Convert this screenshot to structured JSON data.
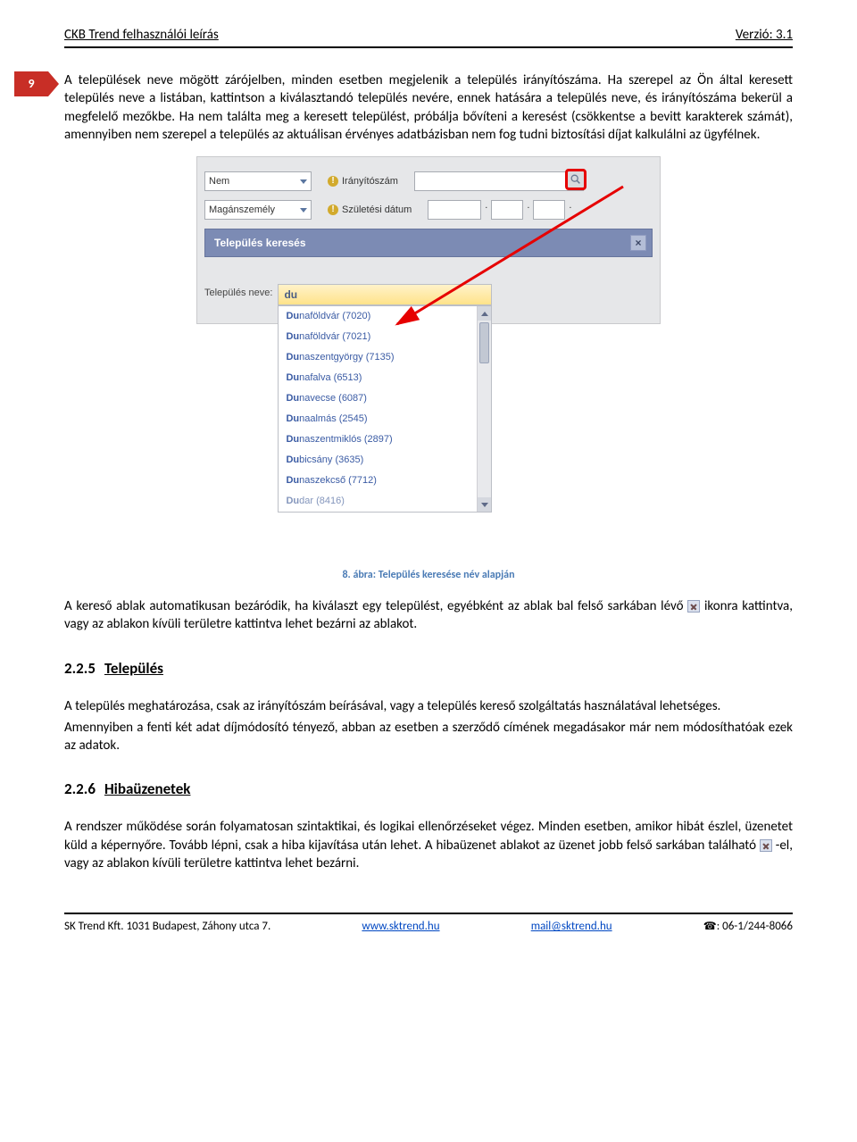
{
  "header": {
    "doc_title": "CKB Trend felhasználói leírás",
    "version": "Verzió: 3.1"
  },
  "page_marker": "9",
  "para1": "A települések neve mögött zárójelben, minden esetben megjelenik a település irányítószáma. Ha szerepel az Ön által keresett település neve a listában, kattintson a kiválasztandó település nevére, ennek hatására a település neve, és irányítószáma bekerül a megfelelő mezőkbe. Ha nem találta meg a keresett települést, próbálja bővíteni a keresést (csökkentse a bevitt karakterek számát), amennyiben nem szerepel a település az aktuálisan érvényes adatbázisban nem fog tudni biztosítási díjat kalkulálni az ügyfélnek.",
  "screenshot": {
    "select1": "Nem",
    "select2": "Magánszemély",
    "label_irsz": "Irányítószám",
    "label_szul": "Születési dátum",
    "dialog_title": "Település keresés",
    "search_label": "Település neve:",
    "search_value": "du",
    "options": [
      {
        "pre": "Du",
        "rest": "naföldvár (7020)"
      },
      {
        "pre": "Du",
        "rest": "naföldvár (7021)"
      },
      {
        "pre": "Du",
        "rest": "naszentgyörgy (7135)"
      },
      {
        "pre": "Du",
        "rest": "nafalva (6513)"
      },
      {
        "pre": "Du",
        "rest": "navecse (6087)"
      },
      {
        "pre": "Du",
        "rest": "naalmás (2545)"
      },
      {
        "pre": "Du",
        "rest": "naszentmiklós (2897)"
      },
      {
        "pre": "Du",
        "rest": "bicsány (3635)"
      },
      {
        "pre": "Du",
        "rest": "naszekcső (7712)"
      },
      {
        "pre": "Du",
        "rest": "dar (8416)"
      }
    ]
  },
  "caption": "8. ábra: Település keresése név alapján",
  "para2a": "A kereső ablak automatikusan bezáródik, ha kiválaszt egy települést, egyébként az ablak bal felső sarkában lévő ",
  "para2b": " ikonra kattintva, vagy az ablakon kívüli területre kattintva lehet bezárni az ablakot.",
  "section_225": {
    "num": "2.2.5",
    "title": "Település"
  },
  "para3": "A település meghatározása, csak az irányítószám beírásával, vagy a település kereső szolgáltatás használatával lehetséges.",
  "para4": "Amennyiben a fenti két adat díjmódosító tényező, abban az esetben a szerződő címének megadásakor már nem módosíthatóak ezek az adatok.",
  "section_226": {
    "num": "2.2.6",
    "title": "Hibaüzenetek"
  },
  "para5a": "A rendszer működése során folyamatosan szintaktikai, és logikai ellenőrzéseket végez. Minden esetben, amikor hibát észlel, üzenetet küld a képernyőre. Tovább lépni, csak a hiba kijavítása után lehet. A hibaüzenet ablakot az üzenet jobb felső sarkában található ",
  "para5b": " -el, vagy az ablakon kívüli területre kattintva lehet bezárni.",
  "footer": {
    "company": "SK Trend Kft. 1031 Budapest, Záhony utca 7.",
    "web": "www.sktrend.hu",
    "mail": "mail@sktrend.hu",
    "tel_label": ": 06-1/244-8066"
  }
}
